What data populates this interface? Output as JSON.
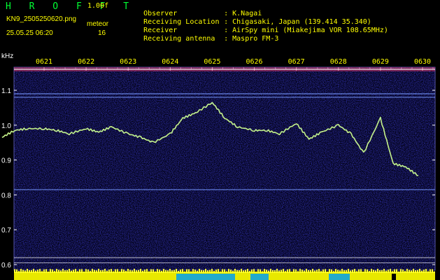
{
  "header": {
    "brand": "H R O F F T",
    "version": "1.00f",
    "filename": "KN9_2505250620.png",
    "meteor_label": "meteor",
    "datetime": "25.05.25 06:20",
    "meteor_count": "16",
    "info": [
      {
        "label": "Observer",
        "value": ": K.Nagai"
      },
      {
        "label": "Receiving Location",
        "value": ": Chigasaki, Japan (139.414 35.340)"
      },
      {
        "label": "Receiver",
        "value": ": AirSpy mini (Miakejima VOR 108.65MHz)"
      },
      {
        "label": "Receiving antenna",
        "value": ": Maspro FM-3"
      }
    ]
  },
  "chart_data": {
    "type": "spectrogram",
    "y_unit": "kHz",
    "y_ticks": [
      "1.1",
      "1.0",
      "0.9",
      "0.8",
      "0.7",
      "0.6"
    ],
    "x_ticks": [
      "0621",
      "0622",
      "0623",
      "0624",
      "0625",
      "0626",
      "0627",
      "0628",
      "0629",
      "0630"
    ],
    "ylim": [
      0.58,
      1.18
    ],
    "fixed_lines_khz": [
      1.09,
      1.08,
      0.815,
      0.62,
      0.605
    ],
    "trace": {
      "x_min": [
        20.0,
        20.3,
        20.6,
        21.0,
        21.3,
        21.6,
        22.0,
        22.3,
        22.6,
        23.0,
        23.3,
        23.6,
        24.0,
        24.3,
        24.6,
        25.0,
        25.3,
        25.6,
        26.0,
        26.3,
        26.6,
        27.0,
        27.3,
        27.6,
        28.0,
        28.3,
        28.6,
        29.0,
        29.3,
        29.6,
        29.9
      ],
      "khz": [
        0.965,
        0.985,
        0.99,
        0.99,
        0.985,
        0.975,
        0.99,
        0.98,
        0.995,
        0.975,
        0.965,
        0.95,
        0.975,
        1.02,
        1.035,
        1.065,
        1.02,
        0.995,
        0.985,
        0.985,
        0.975,
        1.005,
        0.96,
        0.98,
        1.0,
        0.975,
        0.92,
        1.02,
        0.89,
        0.88,
        0.855
      ]
    }
  }
}
